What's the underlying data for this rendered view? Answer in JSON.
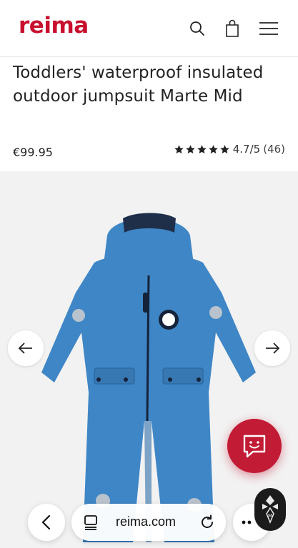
{
  "header": {
    "logo": "reima",
    "brand_color": "#c8102e",
    "icons": [
      "search-icon",
      "shopping-bag-icon",
      "hamburger-menu-icon"
    ]
  },
  "product": {
    "title": "Toddlers' waterproof insulated outdoor jumpsuit Marte Mid",
    "price": "€99.95",
    "rating": {
      "stars": 5,
      "score_text": "4.7/5",
      "count_text": "(46)"
    },
    "image_alt_color": "#3f86c6"
  },
  "gallery": {
    "prev_icon": "arrow-left-icon",
    "next_icon": "arrow-right-icon"
  },
  "chat": {
    "icon": "chat-smile-icon",
    "color": "#c21b35"
  },
  "browser_bar": {
    "url": "reima.com",
    "back_icon": "chevron-left-icon",
    "tabs_icon": "tabs-icon",
    "reload_icon": "reload-icon",
    "more_icon": "more-dots-icon",
    "extension_icon": "extension-badge-icon"
  }
}
